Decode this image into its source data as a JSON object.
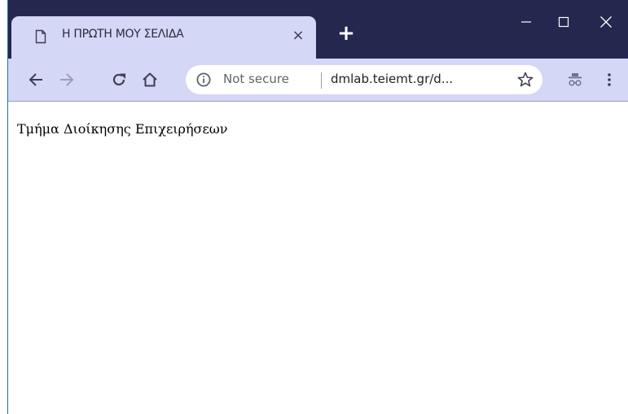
{
  "tab": {
    "title": "Η ΠΡΩΤΗ ΜΟΥ ΣΕΛΙΔΑ",
    "close": "×",
    "page_icon": "page-icon"
  },
  "new_tab": "+",
  "window_controls": [
    "minimize-icon",
    "maximize-icon",
    "close-icon"
  ],
  "toolbar": {
    "icons": [
      "back-arrow-icon",
      "forward-arrow-icon",
      "reload-icon",
      "home-icon",
      "incognito-icon",
      "menu-dots-icon"
    ],
    "address": {
      "security_icon": "info-icon",
      "security_label": "Not secure",
      "url": "dmlab.teiemt.gr/d...",
      "bookmark_icon": "star-icon"
    }
  },
  "page": {
    "text": "Τμήμα Διοίκησης Επιχειρήσεων"
  },
  "colors": {
    "titlebar": "#24274e",
    "tab_active": "#d4d7f5",
    "toolbar": "#d4d7f5",
    "page_background": "#ffffff"
  }
}
